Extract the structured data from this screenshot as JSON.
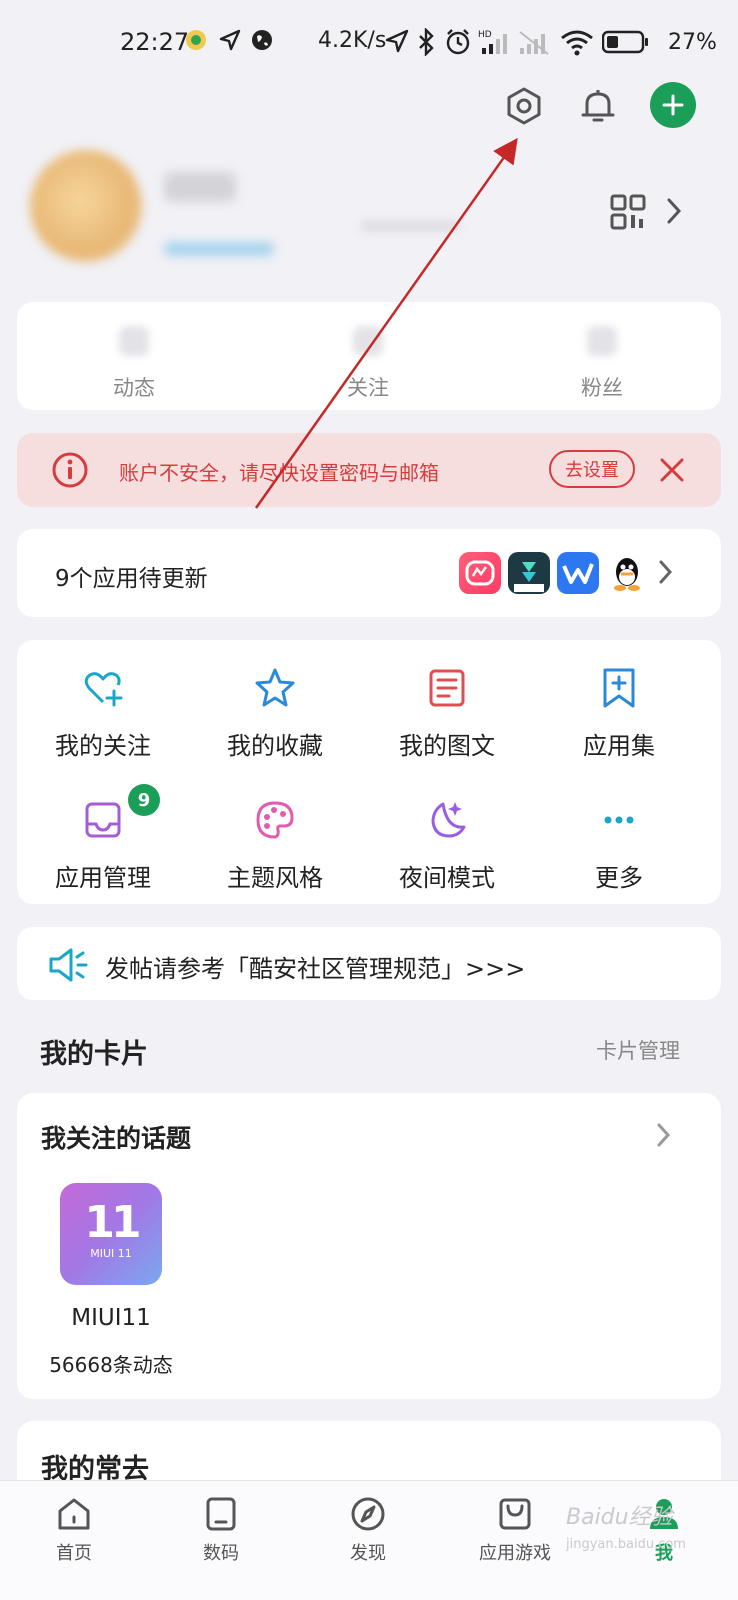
{
  "status_bar": {
    "time": "22:27",
    "net_speed": "4.2K/s",
    "battery": "27%"
  },
  "stats": [
    {
      "label": "动态"
    },
    {
      "label": "关注"
    },
    {
      "label": "粉丝"
    }
  ],
  "alert": {
    "text": "账户不安全，请尽快设置密码与邮箱",
    "action": "去设置"
  },
  "updates": {
    "text": "9个应用待更新"
  },
  "grid": [
    {
      "label": "我的关注",
      "icon": "heart-plus-icon",
      "color": "#19a7c9"
    },
    {
      "label": "我的收藏",
      "icon": "star-icon",
      "color": "#2a8ad8"
    },
    {
      "label": "我的图文",
      "icon": "article-icon",
      "color": "#e04f4f"
    },
    {
      "label": "应用集",
      "icon": "bookmark-plus-icon",
      "color": "#2a8ad8"
    },
    {
      "label": "应用管理",
      "icon": "inbox-icon",
      "color": "#a45ed2",
      "badge": "9"
    },
    {
      "label": "主题风格",
      "icon": "palette-icon",
      "color": "#e35bb0"
    },
    {
      "label": "夜间模式",
      "icon": "moon-icon",
      "color": "#9a5fe0"
    },
    {
      "label": "更多",
      "icon": "more-icon",
      "color": "#19a7c9"
    }
  ],
  "notice": {
    "text": "发帖请参考「酷安社区管理规范」>>>"
  },
  "cards_section": {
    "title": "我的卡片",
    "manage": "卡片管理"
  },
  "topics": {
    "title": "我关注的话题",
    "item": {
      "tile": "11",
      "tile_sub": "MIUI 11",
      "name": "MIUI11",
      "count": "56668条动态"
    }
  },
  "frequent": {
    "title": "我的常去"
  },
  "tabbar": [
    {
      "label": "首页",
      "icon": "home-icon"
    },
    {
      "label": "数码",
      "icon": "tablet-icon"
    },
    {
      "label": "发现",
      "icon": "compass-icon"
    },
    {
      "label": "应用游戏",
      "icon": "bag-icon"
    },
    {
      "label": "我",
      "icon": "profile-icon",
      "active": true
    }
  ],
  "watermark": {
    "text": "Baidu经验",
    "sub": "jingyan.baidu.com"
  },
  "colors": {
    "accent": "#1a9e58",
    "alert": "#d63c3c"
  }
}
